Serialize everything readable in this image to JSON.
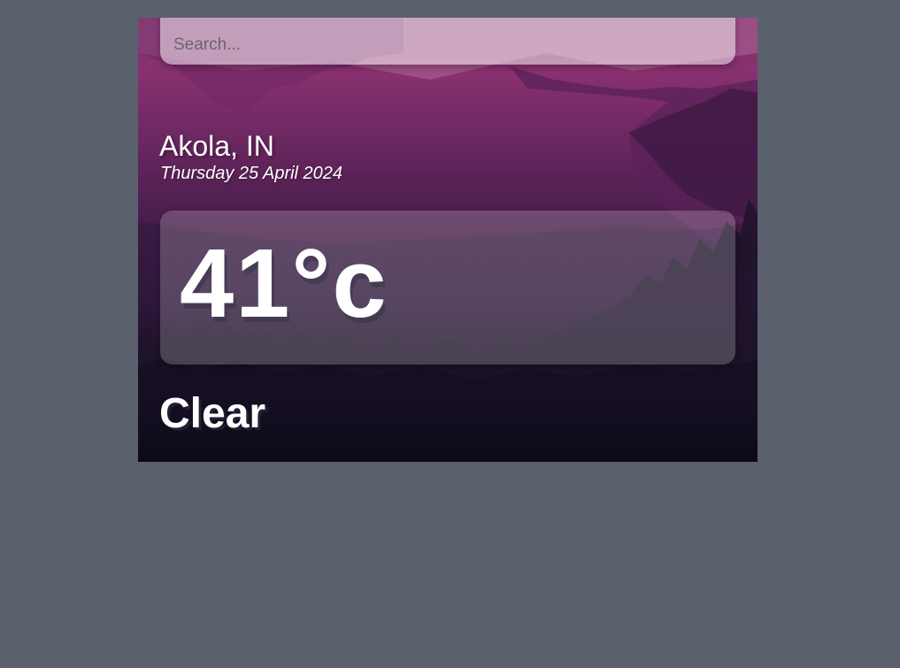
{
  "search": {
    "placeholder": "Search..."
  },
  "location": {
    "city": "Akola, IN",
    "date": "Thursday 25 April 2024"
  },
  "weather": {
    "temperature": "41°c",
    "condition": "Clear"
  },
  "colors": {
    "page_background": "#5b606d",
    "accent_magenta": "#8a3170",
    "deep_night": "#090714",
    "text": "#ffffff"
  }
}
